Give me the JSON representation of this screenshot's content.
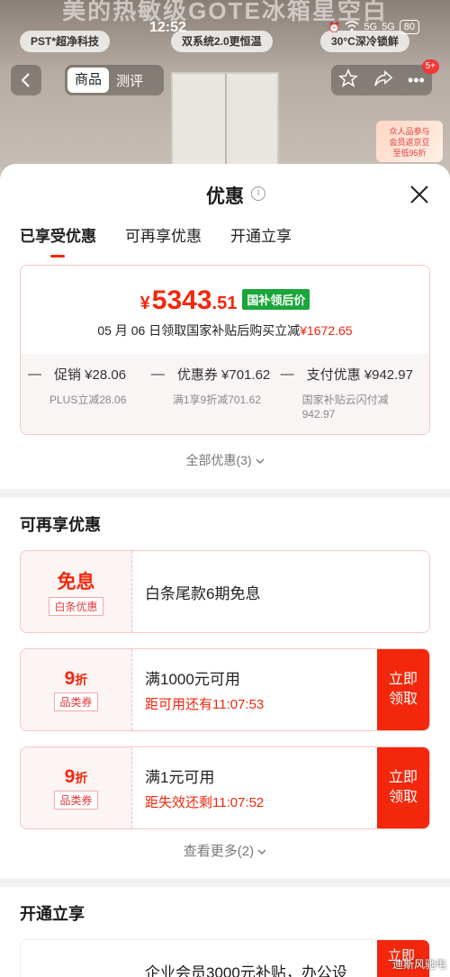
{
  "status_bar": {
    "time": "12:52",
    "network": "5G",
    "battery": "80"
  },
  "background": {
    "banner_title": "美的热敏级GOTE冰箱星空白",
    "chips": [
      "PST*超净科技",
      "双系统2.0更恒温",
      "30°C深冷锁鲜"
    ],
    "tabs": [
      "商品",
      "测评"
    ],
    "badge": "5+",
    "sticker_line1": "众人品参与",
    "sticker_line2": "会员返京豆",
    "sticker_line3": "至低95折"
  },
  "sheet": {
    "title": "优惠",
    "info_icon": "i",
    "tabs": [
      "已享受优惠",
      "可再享优惠",
      "开通立享"
    ],
    "price": {
      "currency": "¥",
      "integer": "5343",
      "decimal": ".51",
      "tag": "国补领后价",
      "desc_prefix": "05 月 06 日领取国家补贴后购买立减",
      "desc_amount": "¥1672.65"
    },
    "breakdown": [
      {
        "title": "促销 ¥28.06",
        "detail": "PLUS立减28.06"
      },
      {
        "title": "优惠券 ¥701.62",
        "detail": "满1享9折减701.62"
      },
      {
        "title": "支付优惠 ¥942.97",
        "detail": "国家补贴云闪付减 942.97"
      }
    ],
    "all_discounts": "全部优惠(3)",
    "section_more": {
      "title": "可再享优惠",
      "coupons": [
        {
          "big": "免息",
          "suffix": "",
          "label": "白条优惠",
          "text": "白条尾款6期免息",
          "sub": "",
          "action": ""
        },
        {
          "big": "9",
          "suffix": "折",
          "label": "品类券",
          "text": "满1000元可用",
          "sub": "距可用还有11:07:53",
          "action": "立即领取"
        },
        {
          "big": "9",
          "suffix": "折",
          "label": "品类券",
          "text": "满1元可用",
          "sub": "距失效还剩11:07:52",
          "action": "立即领取"
        }
      ],
      "see_more": "查看更多(2)"
    },
    "section_member": {
      "title": "开通立享",
      "card_text": "企业会员3000元补贴，办公设",
      "action": "立即"
    },
    "watermark": "迪斯风驰电"
  },
  "colors": {
    "accent": "#f2270c",
    "green_tag": "#1aa63a"
  }
}
